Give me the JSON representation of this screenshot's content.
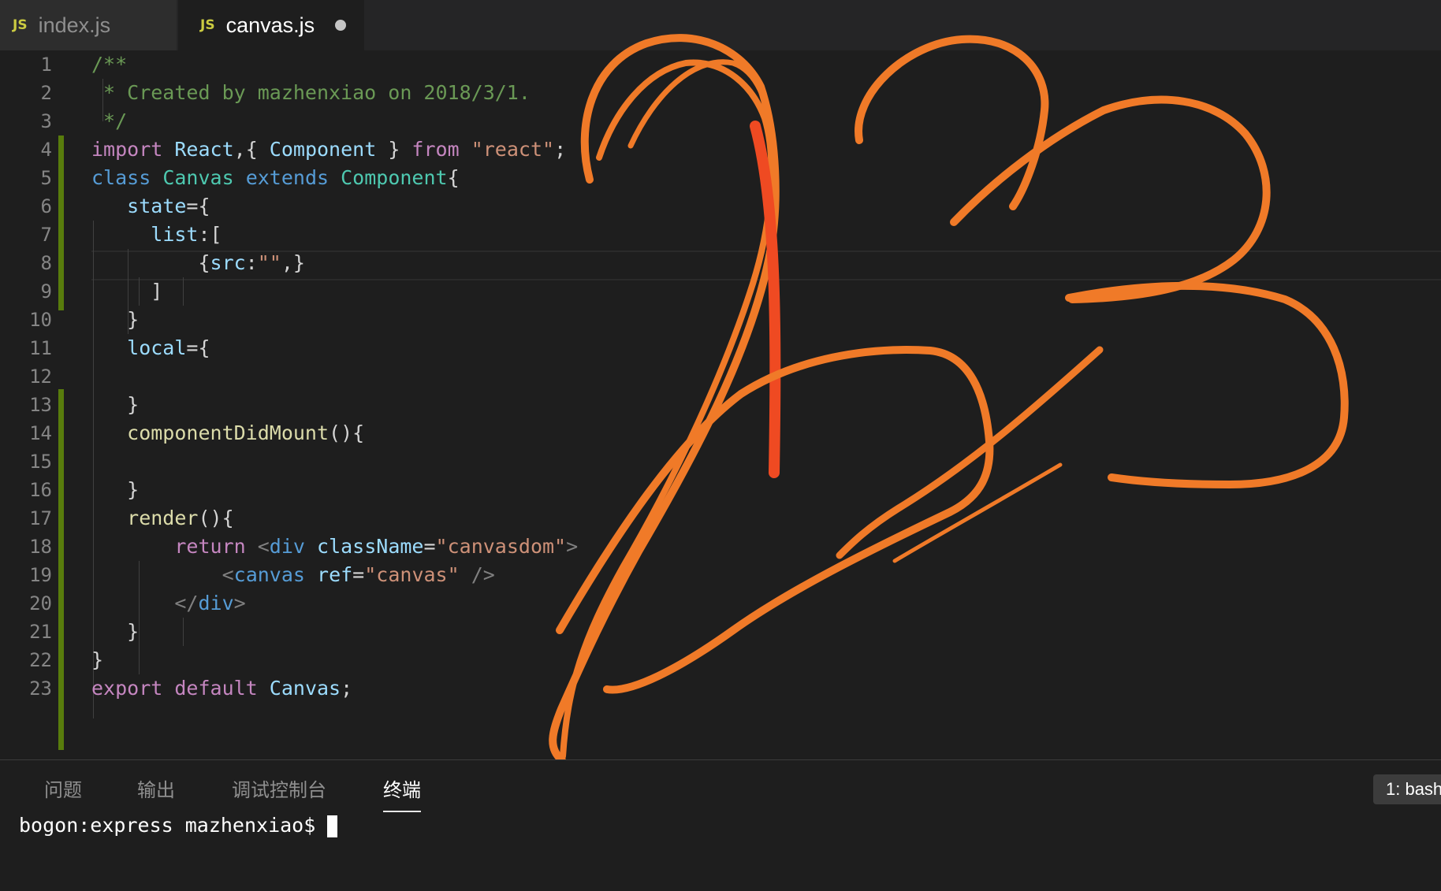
{
  "tabs": [
    {
      "icon": "JS",
      "label": "index.js",
      "active": false
    },
    {
      "icon": "JS",
      "label": "canvas.js",
      "active": true,
      "modified": true
    }
  ],
  "editor": {
    "lines": [
      [
        [
          "/**",
          "cm"
        ]
      ],
      [
        [
          " * Created by mazhenxiao on 2018/3/1.",
          "cm"
        ]
      ],
      [
        [
          " */",
          "cm"
        ]
      ],
      [
        [
          "import",
          "kw"
        ],
        [
          " ",
          "pun"
        ],
        [
          "React",
          "var"
        ],
        [
          ",{ ",
          "pun"
        ],
        [
          "Component",
          "var"
        ],
        [
          " } ",
          "pun"
        ],
        [
          "from",
          "kw"
        ],
        [
          " ",
          "pun"
        ],
        [
          "\"react\"",
          "str"
        ],
        [
          ";",
          "pun"
        ]
      ],
      [
        [
          "class",
          "st"
        ],
        [
          " ",
          "pun"
        ],
        [
          "Canvas",
          "ty"
        ],
        [
          " ",
          "pun"
        ],
        [
          "extends",
          "st"
        ],
        [
          " ",
          "pun"
        ],
        [
          "Component",
          "ty"
        ],
        [
          "{",
          "pun"
        ]
      ],
      [
        [
          "   ",
          "pun"
        ],
        [
          "state",
          "var"
        ],
        [
          "={",
          "pun"
        ]
      ],
      [
        [
          "     ",
          "pun"
        ],
        [
          "list",
          "var"
        ],
        [
          ":[",
          "pun"
        ]
      ],
      [
        [
          "         {",
          "pun"
        ],
        [
          "src",
          "var"
        ],
        [
          ":",
          "pun"
        ],
        [
          "\"\"",
          "str"
        ],
        [
          ",}",
          "pun"
        ]
      ],
      [
        [
          "     ]",
          "pun"
        ]
      ],
      [
        [
          "   }",
          "pun"
        ]
      ],
      [
        [
          "   ",
          "pun"
        ],
        [
          "local",
          "var"
        ],
        [
          "={",
          "pun"
        ]
      ],
      [
        [
          "",
          "pun"
        ]
      ],
      [
        [
          "   }",
          "pun"
        ]
      ],
      [
        [
          "   ",
          "pun"
        ],
        [
          "componentDidMount",
          "fn"
        ],
        [
          "(){",
          "pun"
        ]
      ],
      [
        [
          "",
          "pun"
        ]
      ],
      [
        [
          "   }",
          "pun"
        ]
      ],
      [
        [
          "   ",
          "pun"
        ],
        [
          "render",
          "fn"
        ],
        [
          "(){",
          "pun"
        ]
      ],
      [
        [
          "       ",
          "pun"
        ],
        [
          "return",
          "kw"
        ],
        [
          " ",
          "pun"
        ],
        [
          "<",
          "tag"
        ],
        [
          "div",
          "st"
        ],
        [
          " ",
          "pun"
        ],
        [
          "className",
          "var"
        ],
        [
          "=",
          "pun"
        ],
        [
          "\"canvasdom\"",
          "str"
        ],
        [
          ">",
          "tag"
        ]
      ],
      [
        [
          "           ",
          "pun"
        ],
        [
          "<",
          "tag"
        ],
        [
          "canvas",
          "st"
        ],
        [
          " ",
          "pun"
        ],
        [
          "ref",
          "var"
        ],
        [
          "=",
          "pun"
        ],
        [
          "\"canvas\"",
          "str"
        ],
        [
          " />",
          "tag"
        ]
      ],
      [
        [
          "       ",
          "pun"
        ],
        [
          "</",
          "tag"
        ],
        [
          "div",
          "st"
        ],
        [
          ">",
          "tag"
        ]
      ],
      [
        [
          "   }",
          "pun"
        ]
      ],
      [
        [
          "}",
          "pun"
        ]
      ],
      [
        [
          "export",
          "kw"
        ],
        [
          " ",
          "pun"
        ],
        [
          "default",
          "kw"
        ],
        [
          " ",
          "pun"
        ],
        [
          "Canvas",
          "var"
        ],
        [
          ";",
          "pun"
        ]
      ]
    ],
    "current_line": 8
  },
  "panel": {
    "tabs": [
      "问题",
      "输出",
      "调试控制台",
      "终端"
    ],
    "active_tab": "终端",
    "terminal_select": "1: bash",
    "prompt": "bogon:express mazhenxiao$"
  },
  "colors": {
    "scribble": "#f07a28",
    "scribble_red": "#ef4a22",
    "git_modified": "#587c0c"
  }
}
